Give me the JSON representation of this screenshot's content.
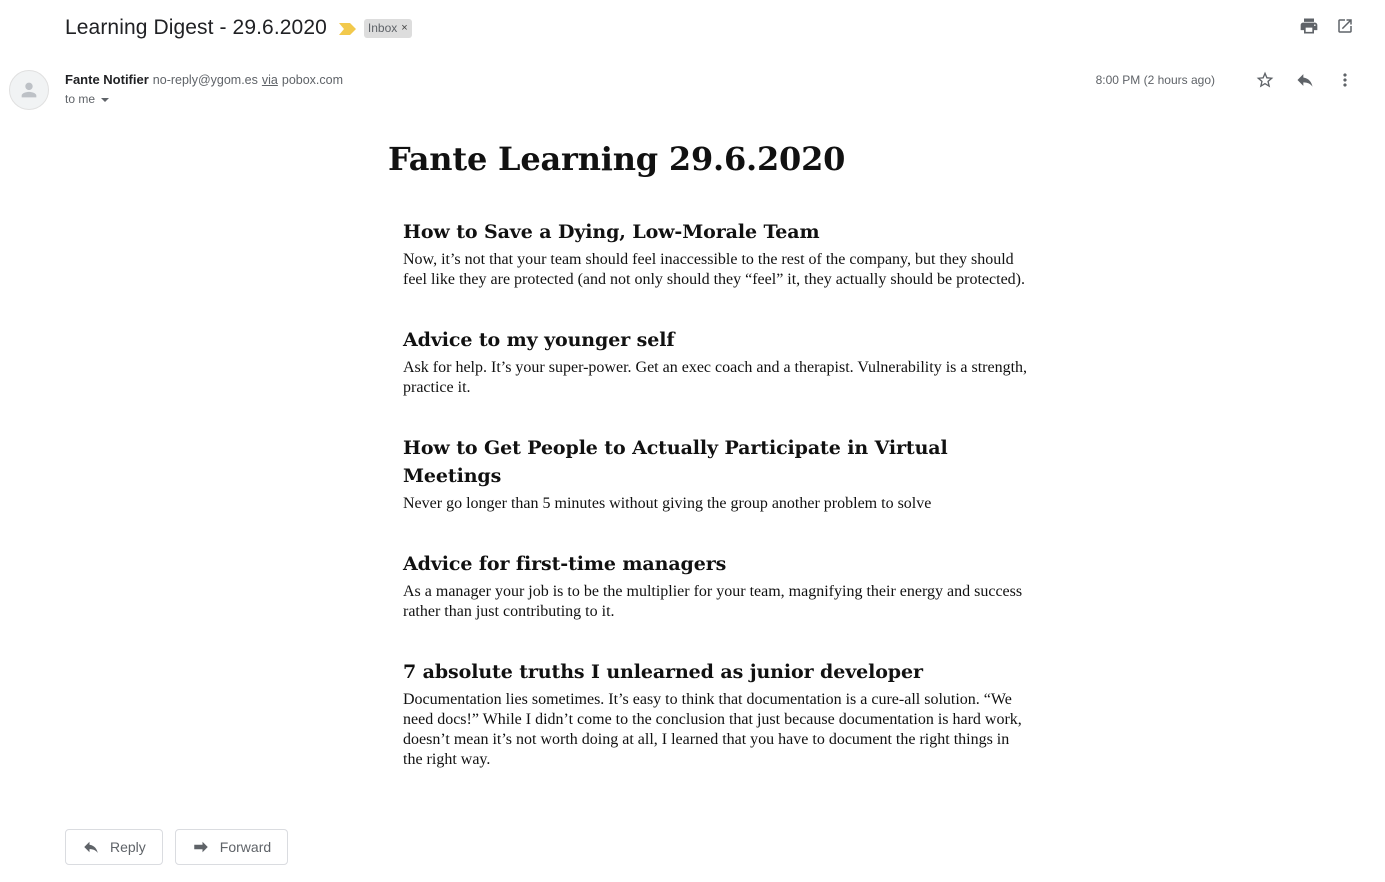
{
  "subject": "Learning Digest - 29.6.2020",
  "label": "Inbox",
  "label_remove": "×",
  "colors": {
    "importance": "#f2c94c",
    "icon_gray": "#5f6368"
  },
  "top_actions": {
    "print_icon": "print-icon",
    "new_window_icon": "open-in-new-window-icon"
  },
  "sender": {
    "name": "Fante Notifier",
    "email": "no-reply@ygom.es",
    "via_label": "via",
    "via_domain": "pobox.com",
    "to": "to me"
  },
  "meta": {
    "timestamp": "8:00 PM (2 hours ago)"
  },
  "digest": {
    "title": "Fante Learning 29.6.2020",
    "articles": [
      {
        "title": "How to Save a Dying, Low-Morale Team",
        "excerpt": "Now, it’s not that your team should feel inaccessible to the rest of the company, but they should feel like they are protected (and not only should they “feel” it, they actually should be protected)."
      },
      {
        "title": "Advice to my younger self",
        "excerpt": "Ask for help. It’s your super-power. Get an exec coach and a therapist. Vulnerability is a strength, practice it."
      },
      {
        "title": "How to Get People to Actually Participate in Virtual Meetings",
        "excerpt": "Never go longer than 5 minutes without giving the group another problem to solve"
      },
      {
        "title": "Advice for first-time managers",
        "excerpt": "As a manager your job is to be the multiplier for your team, magnifying their energy and success rather than just contributing to it."
      },
      {
        "title": "7 absolute truths I unlearned as junior developer",
        "excerpt": "Documentation lies sometimes. It’s easy to think that documentation is a cure-all solution. “We need docs!” While I didn’t come to the conclusion that just because documentation is hard work, doesn’t mean it’s not worth doing at all, I learned that you have to document the right things in the right way."
      }
    ]
  },
  "actions": {
    "reply": "Reply",
    "forward": "Forward"
  }
}
